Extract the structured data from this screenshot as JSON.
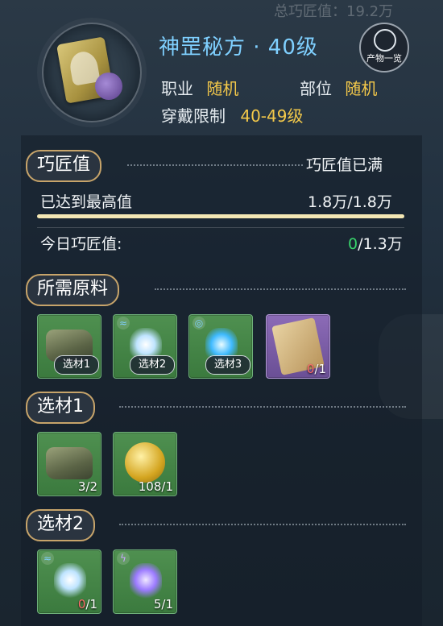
{
  "top": {
    "ghost_text": "总巧匠值：19.2万"
  },
  "header": {
    "title": "神罡秘方 · 40级",
    "catalog_label": "产物一览",
    "profession_label": "职业",
    "profession_value": "随机",
    "slot_label": "部位",
    "slot_value": "随机",
    "wear_label": "穿戴限制",
    "wear_value": "40-49级"
  },
  "craft": {
    "section_title": "巧匠值",
    "status": "巧匠值已满",
    "max_label": "已达到最高值",
    "max_value": "1.8万/1.8万",
    "progress": 1.0,
    "today_label": "今日巧匠值:",
    "today_current": "0",
    "today_total": "/1.3万"
  },
  "materials": {
    "section_title": "所需原料",
    "slots": [
      {
        "tag": "选材1"
      },
      {
        "tag": "选材2"
      },
      {
        "tag": "选材3"
      },
      {
        "count_current": "0",
        "count_total": "/1"
      }
    ]
  },
  "choice1": {
    "section_title": "选材1",
    "slots": [
      {
        "count": "3/2"
      },
      {
        "count": "108/1"
      }
    ]
  },
  "choice2": {
    "section_title": "选材2",
    "slots": [
      {
        "count_current": "0",
        "count_total": "/1"
      },
      {
        "count": "5/1"
      }
    ]
  },
  "colors": {
    "accent_gold": "#f4c94a",
    "title_blue": "#7fd0ff",
    "green_count": "#38d36b",
    "red_count": "#ff6b6b"
  }
}
